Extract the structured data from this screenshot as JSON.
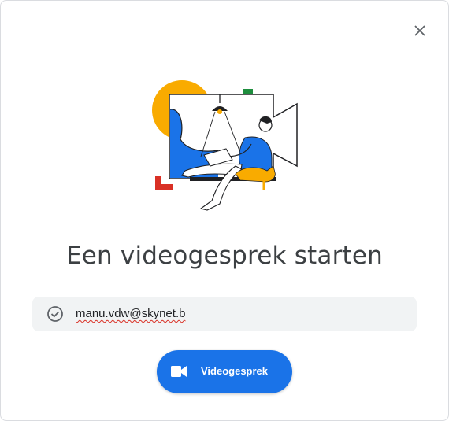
{
  "dialog": {
    "title": "Een videogesprek starten",
    "account": {
      "email": "manu.vdw@skynet.b",
      "icon": "check-circle-icon"
    },
    "call_button": {
      "label": "Videogesprek",
      "icon": "videocam-icon"
    },
    "close_icon": "close-icon"
  },
  "colors": {
    "accent": "#1a73e8",
    "yellow": "#f9ab00",
    "red": "#d93025",
    "green": "#1e8e3e"
  }
}
